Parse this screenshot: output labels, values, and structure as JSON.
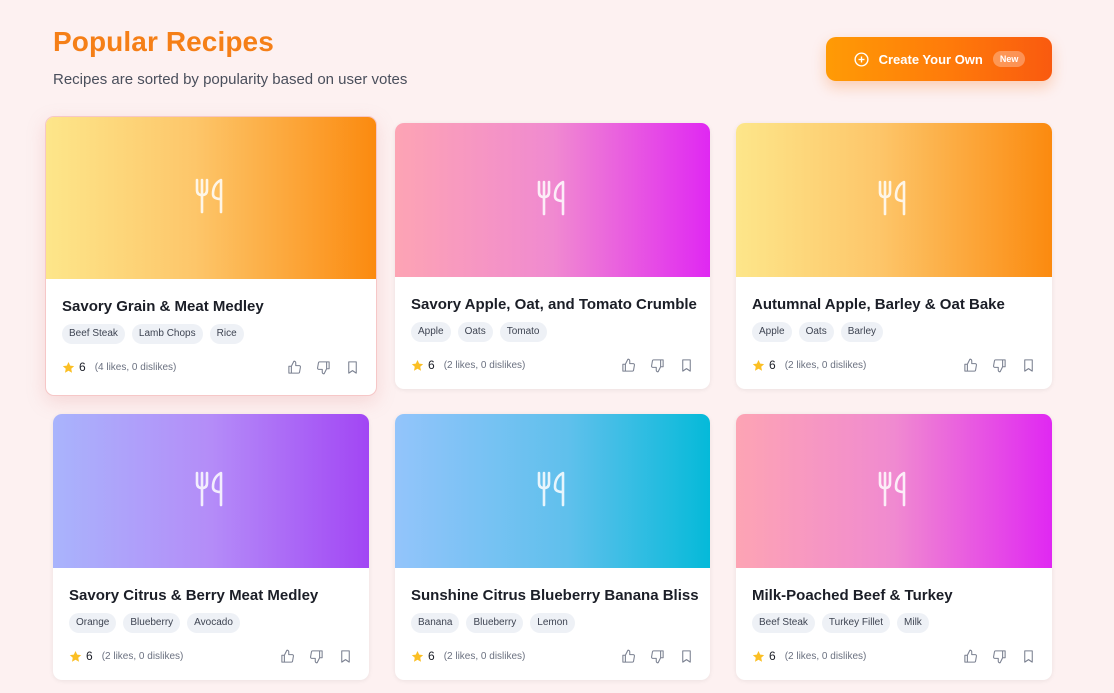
{
  "header": {
    "title": "Popular Recipes",
    "subtitle": "Recipes are sorted by popularity based on user votes"
  },
  "create_button": {
    "label": "Create Your Own",
    "badge": "New",
    "icon": "plus-circle-icon"
  },
  "colors": {
    "accent": "#f57f17",
    "star": "#fbbf24"
  },
  "recipes": [
    {
      "title": "Savory Grain & Meat Medley",
      "tags": [
        "Beef Steak",
        "Lamb Chops",
        "Rice"
      ],
      "score": "6",
      "votes": "(4 likes, 0 dislikes)",
      "gradient": "yellow-orange"
    },
    {
      "title": "Savory Apple, Oat, and Tomato Crumble",
      "tags": [
        "Apple",
        "Oats",
        "Tomato"
      ],
      "score": "6",
      "votes": "(2 likes, 0 dislikes)",
      "gradient": "pink-magenta"
    },
    {
      "title": "Autumnal Apple, Barley & Oat Bake",
      "tags": [
        "Apple",
        "Oats",
        "Barley"
      ],
      "score": "6",
      "votes": "(2 likes, 0 dislikes)",
      "gradient": "yellow-orange"
    },
    {
      "title": "Savory Citrus & Berry Meat Medley",
      "tags": [
        "Orange",
        "Blueberry",
        "Avocado"
      ],
      "score": "6",
      "votes": "(2 likes, 0 dislikes)",
      "gradient": "indigo-violet"
    },
    {
      "title": "Sunshine Citrus Blueberry Banana Bliss",
      "tags": [
        "Banana",
        "Blueberry",
        "Lemon"
      ],
      "score": "6",
      "votes": "(2 likes, 0 dislikes)",
      "gradient": "blue-cyan"
    },
    {
      "title": "Milk-Poached Beef & Turkey",
      "tags": [
        "Beef Steak",
        "Turkey Fillet",
        "Milk"
      ],
      "score": "6",
      "votes": "(2 likes, 0 dislikes)",
      "gradient": "pink-magenta"
    }
  ]
}
